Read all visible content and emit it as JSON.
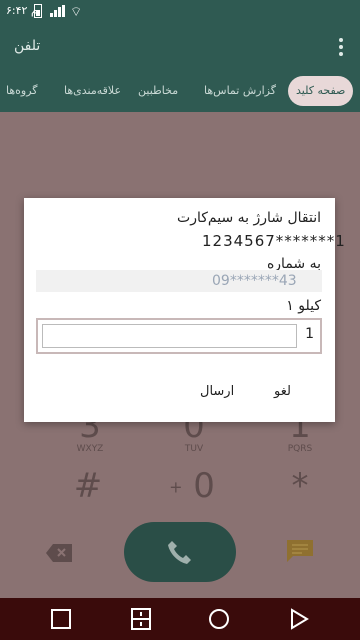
{
  "status_bar": {
    "time": "۶:۴۲ م",
    "icons": [
      "battery-icon",
      "signal-icon",
      "wifi-icon"
    ]
  },
  "app_bar": {
    "title": "تلفن",
    "menu_icon": "more-vert-icon"
  },
  "tabs": [
    {
      "label": "صفحه کلید",
      "active": true
    },
    {
      "label": "گزارش تماس‌ها",
      "active": false
    },
    {
      "label": "مخاطبین",
      "active": false
    },
    {
      "label": "علاقه‌مندی‌ها",
      "active": false
    },
    {
      "label": "گروه‌ها",
      "active": false
    }
  ],
  "dialpad": {
    "keys": [
      {
        "digit": "1",
        "letters": "PQRS"
      },
      {
        "digit": "0",
        "letters": "TUV"
      },
      {
        "digit": "3",
        "letters": "WXYZ"
      },
      {
        "digit": "*",
        "letters": ""
      },
      {
        "digit": "0",
        "letters": "+"
      },
      {
        "digit": "#",
        "letters": ""
      }
    ]
  },
  "dialog": {
    "line1": "انتقال شارژ به سیم‌کارت",
    "masked_number": "1234567*******1",
    "line2": "به شماره",
    "masked_target": "09*******43",
    "line3": "۱ کیلو",
    "pin_value": "1",
    "ok_label": "ارسال",
    "cancel_label": "لغو"
  },
  "colors": {
    "primary": "#2f5a52",
    "dim_overlay": "#8a7272",
    "nav": "#3a0b0b"
  }
}
